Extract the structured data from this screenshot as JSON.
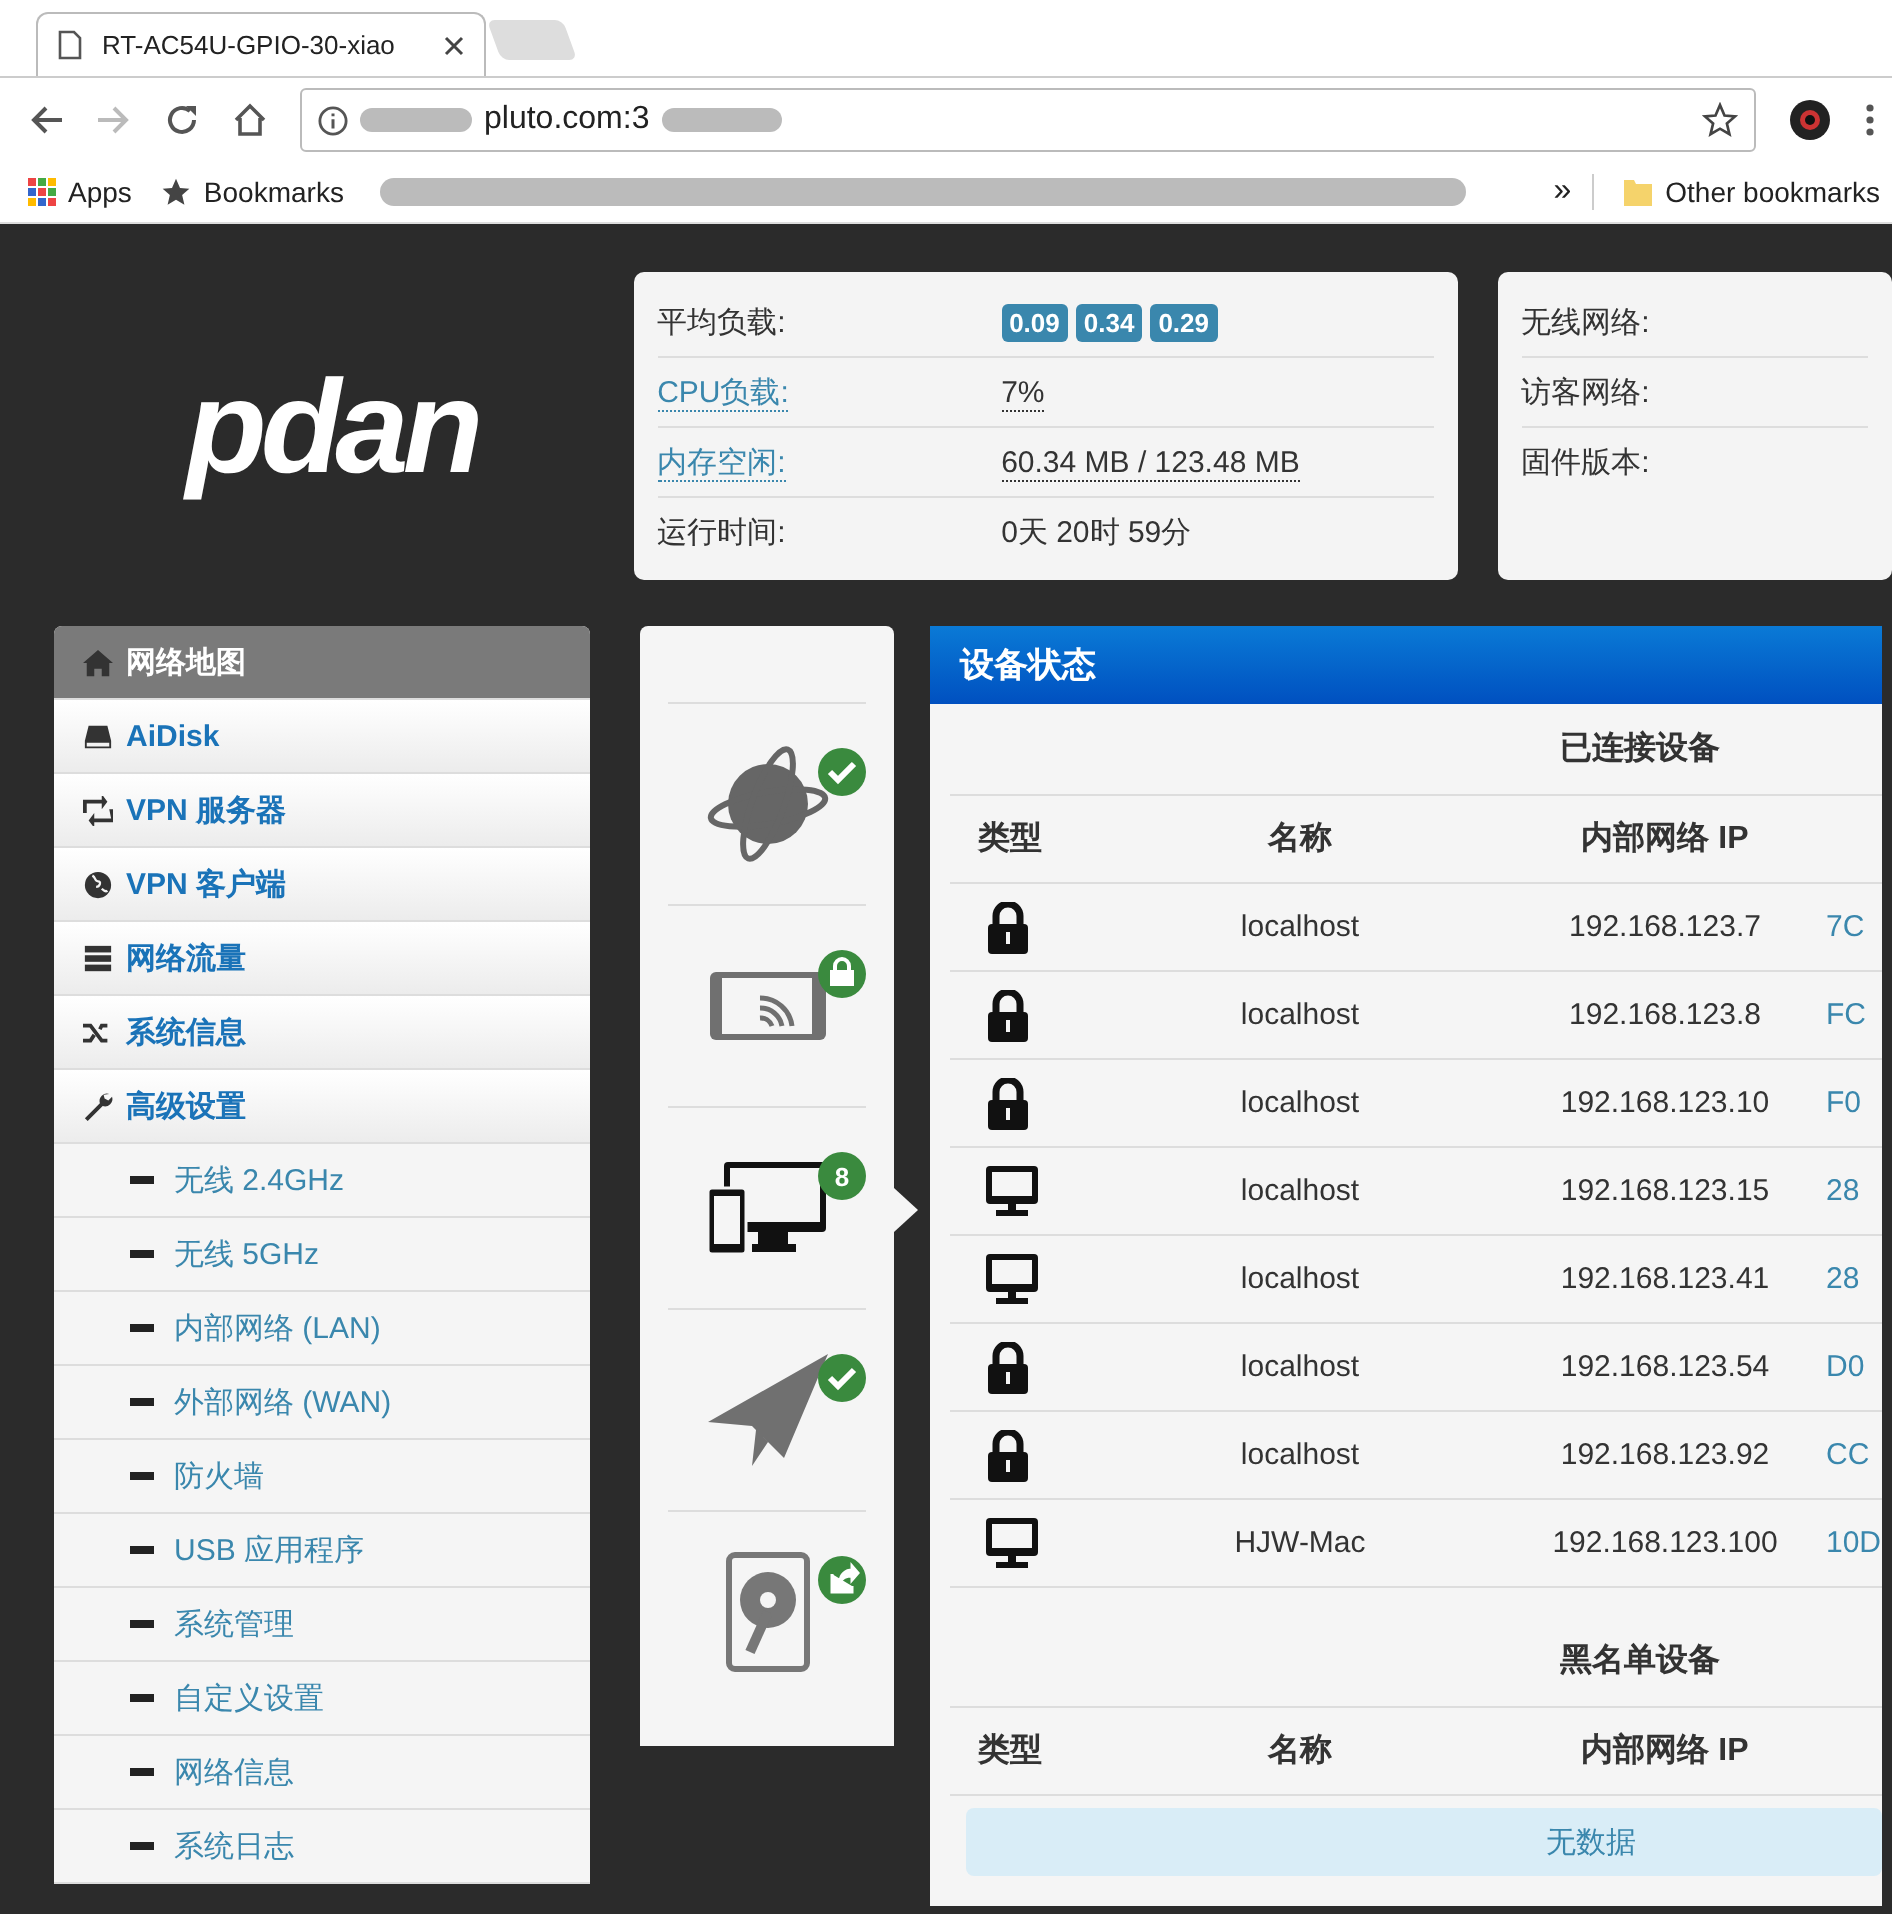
{
  "browser": {
    "tab_title": "RT-AC54U-GPIO-30-xiao",
    "url": "pluto.com:3",
    "bookmarks": [
      {
        "kind": "apps",
        "label": "Apps"
      },
      {
        "kind": "star",
        "label": "Bookmarks"
      }
    ],
    "overflow": "»",
    "other_bookmarks": "Other bookmarks"
  },
  "logo": "pdan",
  "system_stats": [
    {
      "label": "平均负载:",
      "link": false,
      "badges": [
        "0.09",
        "0.34",
        "0.29"
      ]
    },
    {
      "label": "CPU负载:",
      "link": true,
      "value": "7%"
    },
    {
      "label": "内存空闲:",
      "link": true,
      "value": "60.34 MB / 123.48 MB"
    },
    {
      "label": "运行时间:",
      "link": false,
      "value": "0天 20时 59分"
    }
  ],
  "status_labels": [
    "无线网络:",
    "访客网络:",
    "固件版本:"
  ],
  "sidebar": [
    {
      "kind": "home",
      "label": "网络地图",
      "selected": true
    },
    {
      "kind": "hdd",
      "label": "AiDisk",
      "selected": false
    },
    {
      "kind": "retweet",
      "label": "VPN 服务器",
      "selected": false
    },
    {
      "kind": "globe",
      "label": "VPN 客户端",
      "selected": false
    },
    {
      "kind": "list",
      "label": "网络流量",
      "selected": false
    },
    {
      "kind": "shuffle",
      "label": "系统信息",
      "selected": false
    },
    {
      "kind": "wrench",
      "label": "高级设置",
      "selected": false,
      "children": [
        {
          "label": "无线 2.4GHz",
          "selected": false
        },
        {
          "label": "无线 5GHz",
          "selected": false
        },
        {
          "label": "内部网络 (LAN)",
          "selected": false
        },
        {
          "label": "外部网络 (WAN)",
          "selected": false
        },
        {
          "label": "防火墙",
          "selected": false
        },
        {
          "label": "USB 应用程序",
          "selected": false
        },
        {
          "label": "系统管理",
          "selected": false
        },
        {
          "label": "自定义设置",
          "selected": false
        },
        {
          "label": "网络信息",
          "selected": false
        },
        {
          "label": "系统日志",
          "selected": false
        }
      ]
    }
  ],
  "status_icons": [
    {
      "kind": "internet",
      "badge": {
        "kind": "check"
      },
      "selected": false
    },
    {
      "kind": "wireless",
      "badge": {
        "kind": "lock"
      },
      "selected": false
    },
    {
      "kind": "devices",
      "badge": {
        "kind": "count",
        "count": "8"
      },
      "selected": true
    },
    {
      "kind": "plane",
      "badge": {
        "kind": "check"
      },
      "selected": false
    },
    {
      "kind": "disk",
      "badge": {
        "kind": "share"
      },
      "selected": false
    }
  ],
  "device_panel": {
    "title": "设备状态",
    "connected_heading": "已连接设备",
    "columns": [
      "类型",
      "名称",
      "内部网络 IP"
    ],
    "rows": [
      {
        "kind": "lock",
        "name": "localhost",
        "ip": "192.168.123.7",
        "column_4": "7C"
      },
      {
        "kind": "lock",
        "name": "localhost",
        "ip": "192.168.123.8",
        "column_4": "FC"
      },
      {
        "kind": "lock",
        "name": "localhost",
        "ip": "192.168.123.10",
        "column_4": "F0"
      },
      {
        "kind": "monitor",
        "name": "localhost",
        "ip": "192.168.123.15",
        "column_4": "28"
      },
      {
        "kind": "monitor",
        "name": "localhost",
        "ip": "192.168.123.41",
        "column_4": "28"
      },
      {
        "kind": "lock",
        "name": "localhost",
        "ip": "192.168.123.54",
        "column_4": "D0"
      },
      {
        "kind": "lock",
        "name": "localhost",
        "ip": "192.168.123.92",
        "column_4": "CC"
      },
      {
        "kind": "monitor",
        "name": "HJW-Mac",
        "ip": "192.168.123.100",
        "column_4": "10D"
      }
    ],
    "blacklist_heading": "黑名单设备",
    "blacklist_columns": [
      "类型",
      "名称",
      "内部网络 IP"
    ],
    "empty_text": "无数据"
  }
}
